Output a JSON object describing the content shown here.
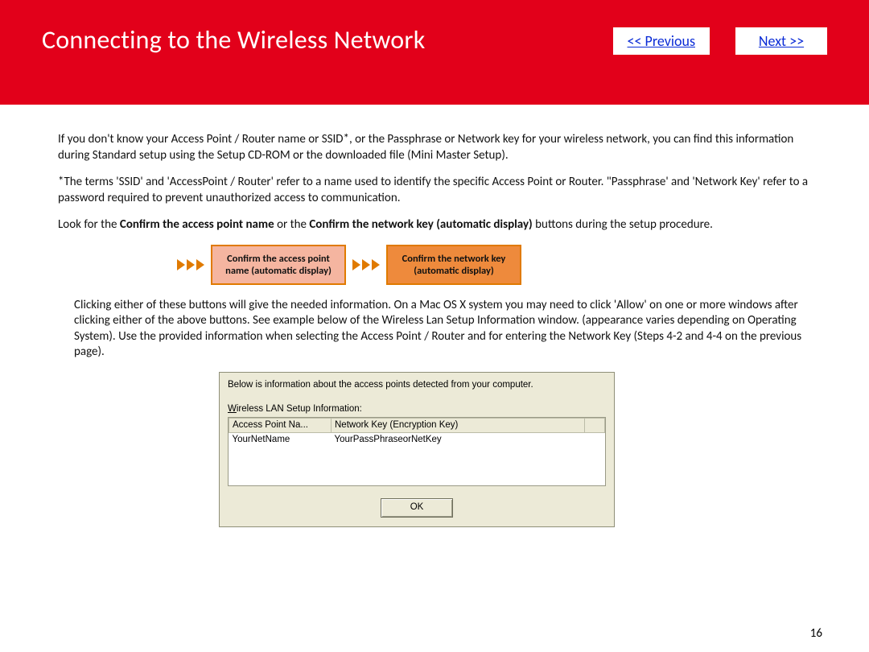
{
  "header": {
    "title": "Connecting to the Wireless Network",
    "prev_label": "<< Previous",
    "next_label": "Next >>"
  },
  "body": {
    "p1": "If you don't know your Access Point / Router name or SSID*, or the Passphrase or Network key for your wireless network, you can find this information during Standard setup using the Setup CD-ROM or the downloaded file (Mini Master Setup).",
    "p2": "*The terms 'SSID' and 'AccessPoint / Router' refer to a name used to identify the specific Access Point or Router. \"Passphrase' and 'Network Key' refer to a password required to prevent unauthorized access to communication.",
    "p3_prefix": "Look for the ",
    "p3_bold1": "Confirm the access point name",
    "p3_mid": " or the ",
    "p3_bold2": "Confirm the network key (automatic display)",
    "p3_suffix": " buttons during the setup procedure.",
    "fig_btn1": "Confirm the access point name (automatic display)",
    "fig_btn2": "Confirm the network key (automatic display)",
    "p4": "Clicking either of these buttons will give the needed information. On a Mac OS X system you may need to click 'Allow' on one or more windows after clicking either of the above buttons. See example below of the Wireless Lan Setup Information window. (appearance varies depending on Operating System). Use the provided information when selecting the Access Point / Router and for entering the Network Key (Steps 4-2 and 4-4 on the previous page)."
  },
  "dialog": {
    "desc": "Below is information about the access points detected from your computer.",
    "label_underline": "W",
    "label_rest": "ireless LAN Setup Information:",
    "col1": "Access Point Na...",
    "col2": "Network Key (Encryption Key)",
    "row_name": "YourNetName",
    "row_key": "YourPassPhraseorNetKey",
    "ok": "OK"
  },
  "page_number": "16"
}
